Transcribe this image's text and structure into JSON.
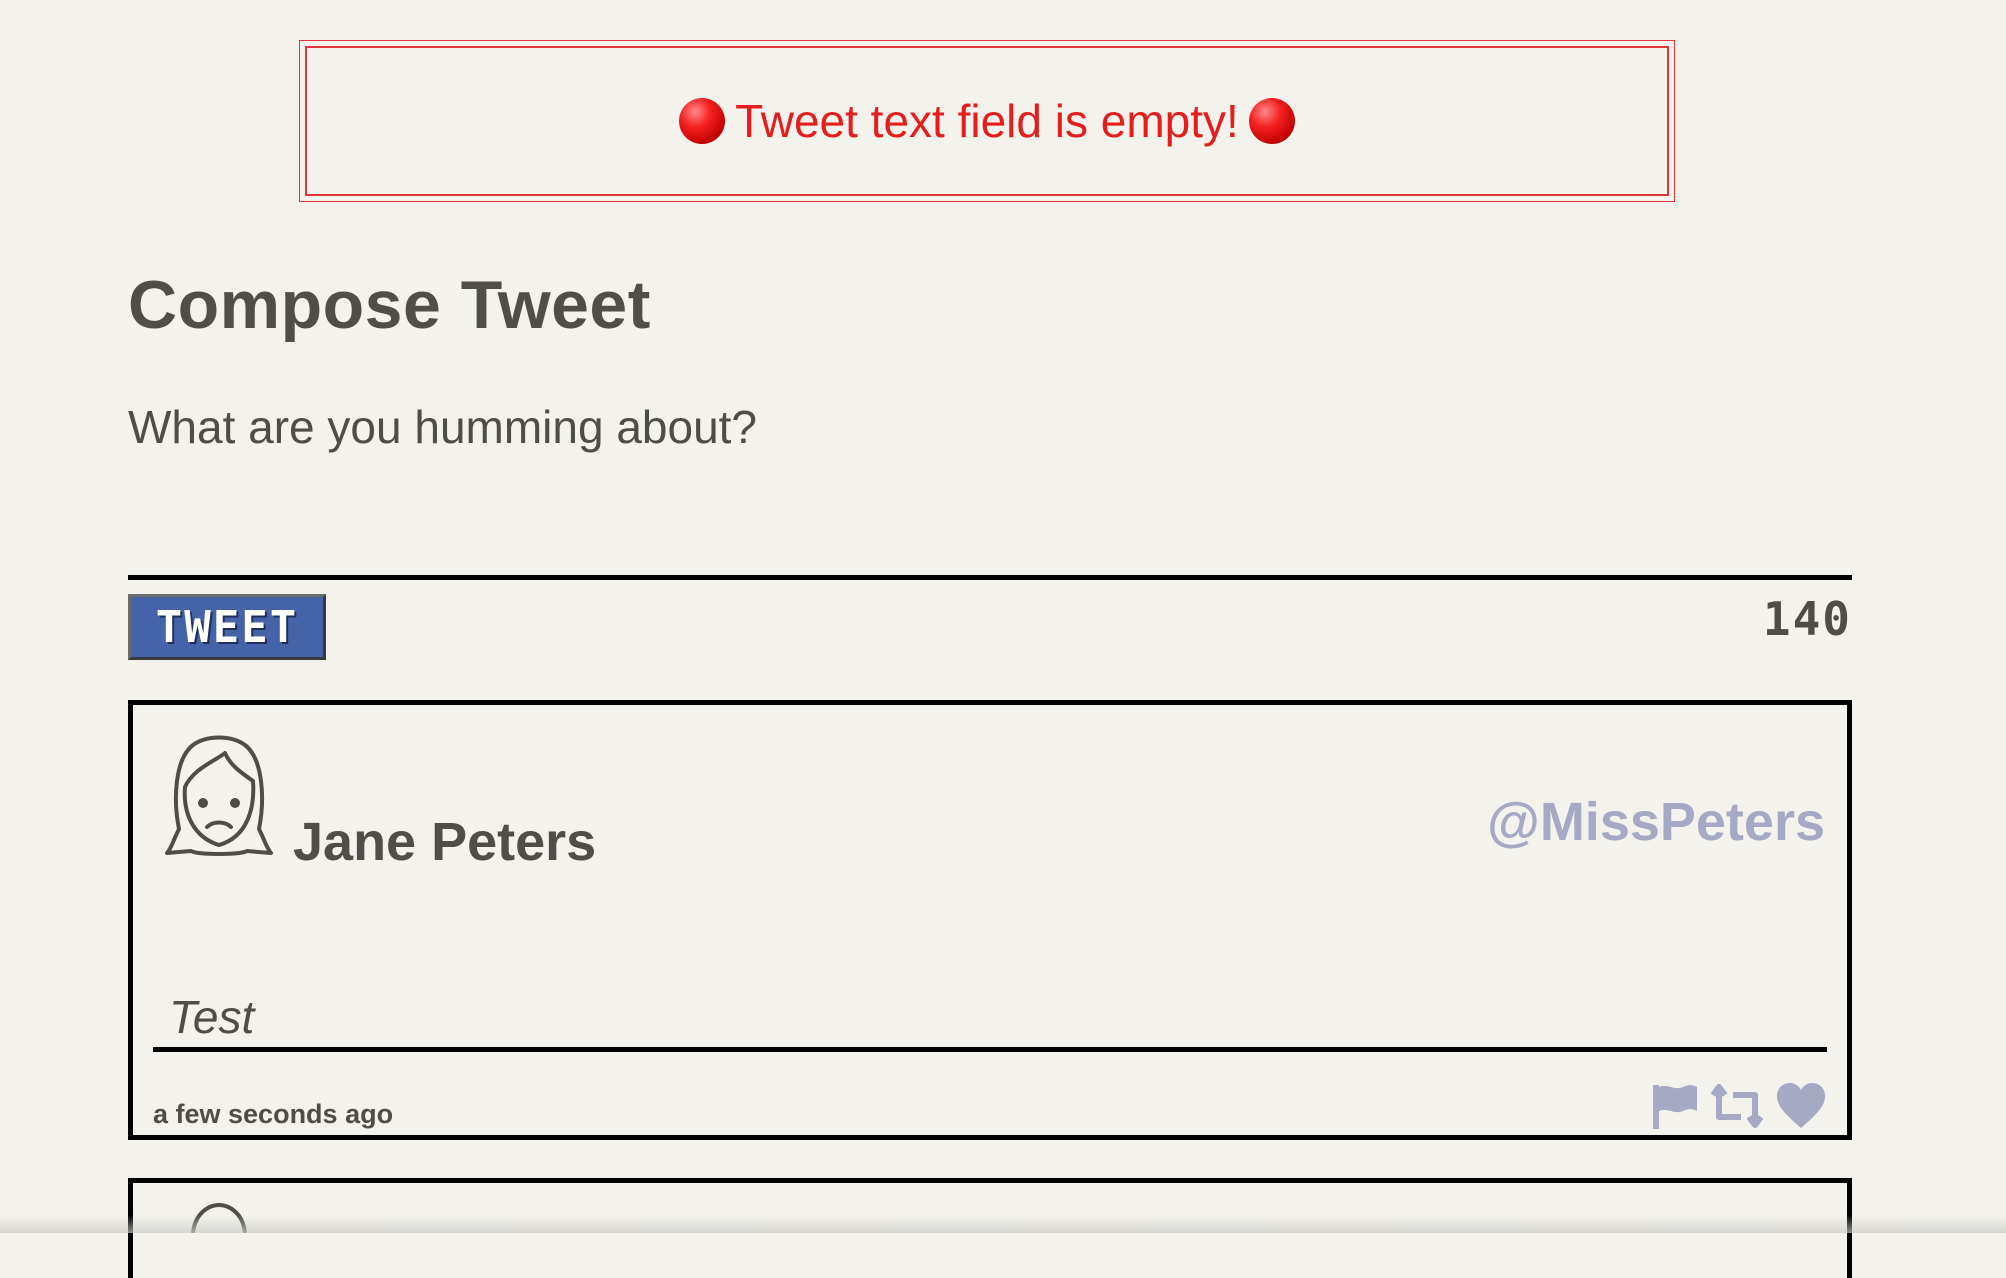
{
  "error": {
    "message": "Tweet text field is empty!",
    "left_icon": "red-circle-icon",
    "right_icon": "red-circle-icon",
    "color": "#e41d1d"
  },
  "compose": {
    "title": "Compose Tweet",
    "placeholder": "What are you humming about?",
    "value": "",
    "button_label": "TWEET",
    "char_count": "140",
    "button_color": "#4563a8"
  },
  "tweets": [
    {
      "avatar_icon": "frowning-woman-icon",
      "name": "Jane Peters",
      "handle": "@MissPeters",
      "text": "Test",
      "time": "a few seconds ago",
      "actions": [
        "flag-icon",
        "retweet-icon",
        "heart-icon"
      ]
    }
  ],
  "colors": {
    "background": "#f3f2ed",
    "text": "#4f4d47",
    "handle": "#a5a9c4",
    "icon": "#a5a9c4"
  }
}
